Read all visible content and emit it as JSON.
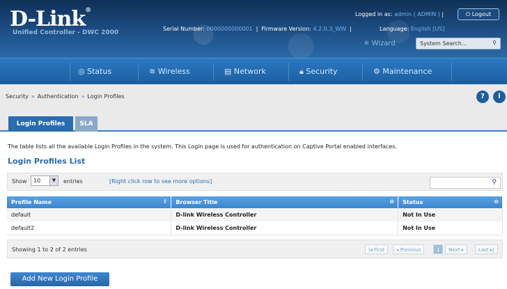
{
  "header": {
    "logo": "D-Link",
    "subtitle": "Unified Controller - DWC 2000",
    "serial_label": "Serial Number:",
    "serial_value": "0000000000001",
    "firmware_label": "Firmware Version:",
    "firmware_value": "4.2.0.3_WW",
    "language_label": "Language:",
    "language_value": "English [US]",
    "logged_label": "Logged in as:",
    "logged_value": "admin ( ADMIN )",
    "logout": "Logout",
    "wizard": "Wizard",
    "search_placeholder": "System Search..."
  },
  "nav": {
    "status": "Status",
    "wireless": "Wireless",
    "network": "Network",
    "security": "Security",
    "maintenance": "Maintenance"
  },
  "breadcrumb": [
    "Security",
    "Authentication",
    "Login Profiles"
  ],
  "tabs": [
    "Login Profiles",
    "SLA"
  ],
  "description": "The table lists all the available Login Profiles in the system. This Login page is used for authentication on Captive Portal enabled interfaces.",
  "list_title": "Login Profiles List",
  "controls": {
    "show": "Show",
    "show_value": "10",
    "entries": "entries",
    "right_click": "[Right click row to see more options]"
  },
  "table": {
    "headers": [
      "Profile Name",
      "Browser Title",
      "Status"
    ],
    "rows": [
      [
        "default",
        "D-link Wireless Controller",
        "Not In Use"
      ],
      [
        "default2",
        "D-link Wireless Controller",
        "Not In Use"
      ]
    ]
  },
  "footer": {
    "showing": "Showing 1 to 2 of 2 entries",
    "first": "First",
    "previous": "Previous",
    "page": "1",
    "next": "Next",
    "last": "Last"
  },
  "add_button": "Add New Login Profile"
}
